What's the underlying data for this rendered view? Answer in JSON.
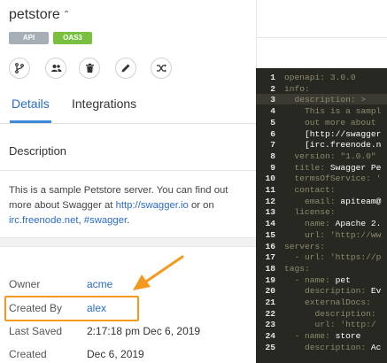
{
  "api": {
    "title": "petstore",
    "badges": [
      "API",
      "OAS3"
    ]
  },
  "actions": [
    {
      "name": "fork-icon"
    },
    {
      "name": "team-icon"
    },
    {
      "name": "delete-icon"
    },
    {
      "name": "edit-icon"
    },
    {
      "name": "shuffle-icon"
    }
  ],
  "tabs": [
    "Details",
    "Integrations"
  ],
  "section": {
    "description_label": "Description"
  },
  "description": {
    "text1": "This is a sample Petstore server. You can find out more about Swagger at",
    "link1": "http://swagger.io",
    "text2": "or on",
    "link2": "irc.freenode.net",
    "text3": ",",
    "link3": "#swagger",
    "text4": "."
  },
  "meta": {
    "owner_label": "Owner",
    "owner_value": "acme",
    "created_by_label": "Created By",
    "created_by_value": "alex",
    "last_saved_label": "Last Saved",
    "last_saved_value": "2:17:18 pm Dec 6, 2019",
    "created_label": "Created",
    "created_value": "Dec 6, 2019"
  },
  "editor_lines": [
    {
      "n": "1",
      "parts": [
        [
          "k",
          "openapi: "
        ],
        [
          "s",
          "3.0.0"
        ]
      ]
    },
    {
      "n": "2",
      "parts": [
        [
          "k",
          "info:"
        ]
      ]
    },
    {
      "n": "3",
      "parts": [
        [
          "k",
          "  description: "
        ],
        [
          "s",
          ">"
        ]
      ]
    },
    {
      "n": "4",
      "parts": [
        [
          "s",
          "    This is a sampl"
        ]
      ]
    },
    {
      "n": "5",
      "parts": [
        [
          "s",
          "    out more about "
        ]
      ]
    },
    {
      "n": "6",
      "parts": [
        [
          "v",
          "    [http://swagger"
        ]
      ]
    },
    {
      "n": "7",
      "parts": [
        [
          "v",
          "    [irc.freenode.n"
        ]
      ]
    },
    {
      "n": "8",
      "parts": [
        [
          "k",
          "  version: "
        ],
        [
          "s",
          "\"1.0.0\""
        ]
      ]
    },
    {
      "n": "9",
      "parts": [
        [
          "k",
          "  title: "
        ],
        [
          "v",
          "Swagger Pe"
        ]
      ]
    },
    {
      "n": "10",
      "parts": [
        [
          "k",
          "  termsOfService: "
        ],
        [
          "s",
          "'"
        ]
      ]
    },
    {
      "n": "11",
      "parts": [
        [
          "k",
          "  contact:"
        ]
      ]
    },
    {
      "n": "12",
      "parts": [
        [
          "k",
          "    email: "
        ],
        [
          "v",
          "apiteam@"
        ]
      ]
    },
    {
      "n": "13",
      "parts": [
        [
          "k",
          "  license:"
        ]
      ]
    },
    {
      "n": "14",
      "parts": [
        [
          "k",
          "    name: "
        ],
        [
          "v",
          "Apache 2."
        ]
      ]
    },
    {
      "n": "15",
      "parts": [
        [
          "k",
          "    url: "
        ],
        [
          "s",
          "'http://ww"
        ]
      ]
    },
    {
      "n": "16",
      "parts": [
        [
          "k",
          "servers:"
        ]
      ]
    },
    {
      "n": "17",
      "parts": [
        [
          "k",
          "  - url: "
        ],
        [
          "s",
          "'https://p"
        ]
      ]
    },
    {
      "n": "18",
      "parts": [
        [
          "k",
          "tags:"
        ]
      ]
    },
    {
      "n": "19",
      "parts": [
        [
          "k",
          "  - name: "
        ],
        [
          "v",
          "pet"
        ]
      ]
    },
    {
      "n": "20",
      "parts": [
        [
          "k",
          "    description: "
        ],
        [
          "v",
          "Ev"
        ]
      ]
    },
    {
      "n": "21",
      "parts": [
        [
          "k",
          "    externalDocs:"
        ]
      ]
    },
    {
      "n": "22",
      "parts": [
        [
          "k",
          "      description: "
        ]
      ]
    },
    {
      "n": "23",
      "parts": [
        [
          "k",
          "      url: "
        ],
        [
          "s",
          "'http:/"
        ]
      ]
    },
    {
      "n": "24",
      "parts": [
        [
          "k",
          "  - name: "
        ],
        [
          "v",
          "store"
        ]
      ]
    },
    {
      "n": "25",
      "parts": [
        [
          "k",
          "    description: "
        ],
        [
          "v",
          "Ac"
        ]
      ]
    }
  ]
}
